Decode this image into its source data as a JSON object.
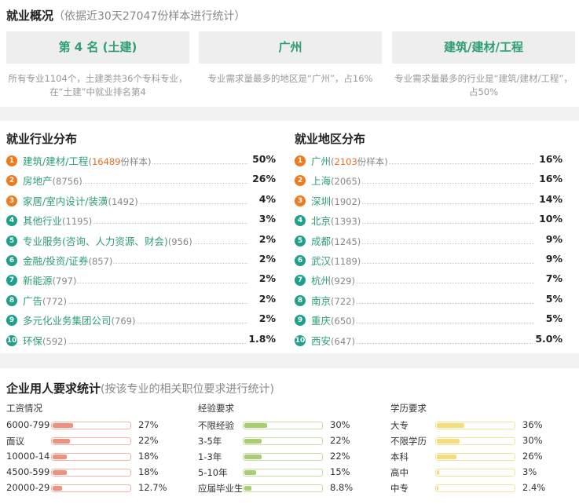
{
  "overview": {
    "title": "就业概况",
    "subtitle": "（依据近30天27047份样本进行统计）",
    "cards": [
      {
        "label": "第 4 名 (土建)",
        "desc": "所有专业1104个，土建类共36个专科专业，在“土建”中就业排名第4"
      },
      {
        "label": "广州",
        "desc": "专业需求量最多的地区是“广州”，占16%"
      },
      {
        "label": "建筑/建材/工程",
        "desc": "专业需求量最多的行业是“建筑/建材/工程”，占50%"
      }
    ]
  },
  "industry": {
    "title": "就业行业分布",
    "items": [
      {
        "rank": "1",
        "name": "建筑/建材/工程",
        "count": "16489",
        "suffix": "份样本",
        "pct": "50%"
      },
      {
        "rank": "2",
        "name": "房地产",
        "count": "8756",
        "pct": "26%"
      },
      {
        "rank": "3",
        "name": "家居/室内设计/装潢",
        "count": "1492",
        "pct": "4%"
      },
      {
        "rank": "4",
        "name": "其他行业",
        "count": "1195",
        "pct": "3%"
      },
      {
        "rank": "5",
        "name": "专业服务(咨询、人力资源、财会)",
        "count": "956",
        "pct": "2%"
      },
      {
        "rank": "6",
        "name": "金融/投资/证券",
        "count": "857",
        "pct": "2%"
      },
      {
        "rank": "7",
        "name": "新能源",
        "count": "797",
        "pct": "2%"
      },
      {
        "rank": "8",
        "name": "广告",
        "count": "772",
        "pct": "2%"
      },
      {
        "rank": "9",
        "name": "多元化业务集团公司",
        "count": "769",
        "pct": "2%"
      },
      {
        "rank": "10",
        "name": "环保",
        "count": "592",
        "pct": "1.8%"
      }
    ]
  },
  "region": {
    "title": "就业地区分布",
    "items": [
      {
        "rank": "1",
        "name": "广州",
        "count": "2103",
        "suffix": "份样本",
        "pct": "16%"
      },
      {
        "rank": "2",
        "name": "上海",
        "count": "2065",
        "pct": "16%"
      },
      {
        "rank": "3",
        "name": "深圳",
        "count": "1902",
        "pct": "14%"
      },
      {
        "rank": "4",
        "name": "北京",
        "count": "1393",
        "pct": "10%"
      },
      {
        "rank": "5",
        "name": "成都",
        "count": "1245",
        "pct": "9%"
      },
      {
        "rank": "6",
        "name": "武汉",
        "count": "1189",
        "pct": "9%"
      },
      {
        "rank": "7",
        "name": "杭州",
        "count": "929",
        "pct": "7%"
      },
      {
        "rank": "8",
        "name": "南京",
        "count": "722",
        "pct": "5%"
      },
      {
        "rank": "9",
        "name": "重庆",
        "count": "650",
        "pct": "5%"
      },
      {
        "rank": "10",
        "name": "西安",
        "count": "647",
        "pct": "5.0%"
      }
    ]
  },
  "requirements": {
    "title": "企业用人要求统计",
    "subtitle": "(按该专业的相关职位要求进行统计)",
    "groups": [
      {
        "key": "salary",
        "title": "工资情况",
        "items": [
          {
            "label": "6000-7999",
            "pct": "27%",
            "value": 27
          },
          {
            "label": "面议",
            "pct": "22%",
            "value": 22
          },
          {
            "label": "10000-149",
            "pct": "18%",
            "value": 18
          },
          {
            "label": "4500-5999",
            "pct": "18%",
            "value": 18
          },
          {
            "label": "20000-299",
            "pct": "12.7%",
            "value": 12.7
          }
        ]
      },
      {
        "key": "experience",
        "title": "经验要求",
        "items": [
          {
            "label": "不限经验",
            "pct": "30%",
            "value": 30
          },
          {
            "label": "3-5年",
            "pct": "22%",
            "value": 22
          },
          {
            "label": "1-3年",
            "pct": "22%",
            "value": 22
          },
          {
            "label": "5-10年",
            "pct": "15%",
            "value": 15
          },
          {
            "label": "应届毕业生",
            "pct": "8.8%",
            "value": 8.8
          }
        ]
      },
      {
        "key": "education",
        "title": "学历要求",
        "items": [
          {
            "label": "大专",
            "pct": "36%",
            "value": 36
          },
          {
            "label": "不限学历",
            "pct": "30%",
            "value": 30
          },
          {
            "label": "本科",
            "pct": "26%",
            "value": 26
          },
          {
            "label": "高中",
            "pct": "3%",
            "value": 3
          },
          {
            "label": "中专",
            "pct": "2.4%",
            "value": 2.4
          }
        ]
      }
    ]
  }
}
